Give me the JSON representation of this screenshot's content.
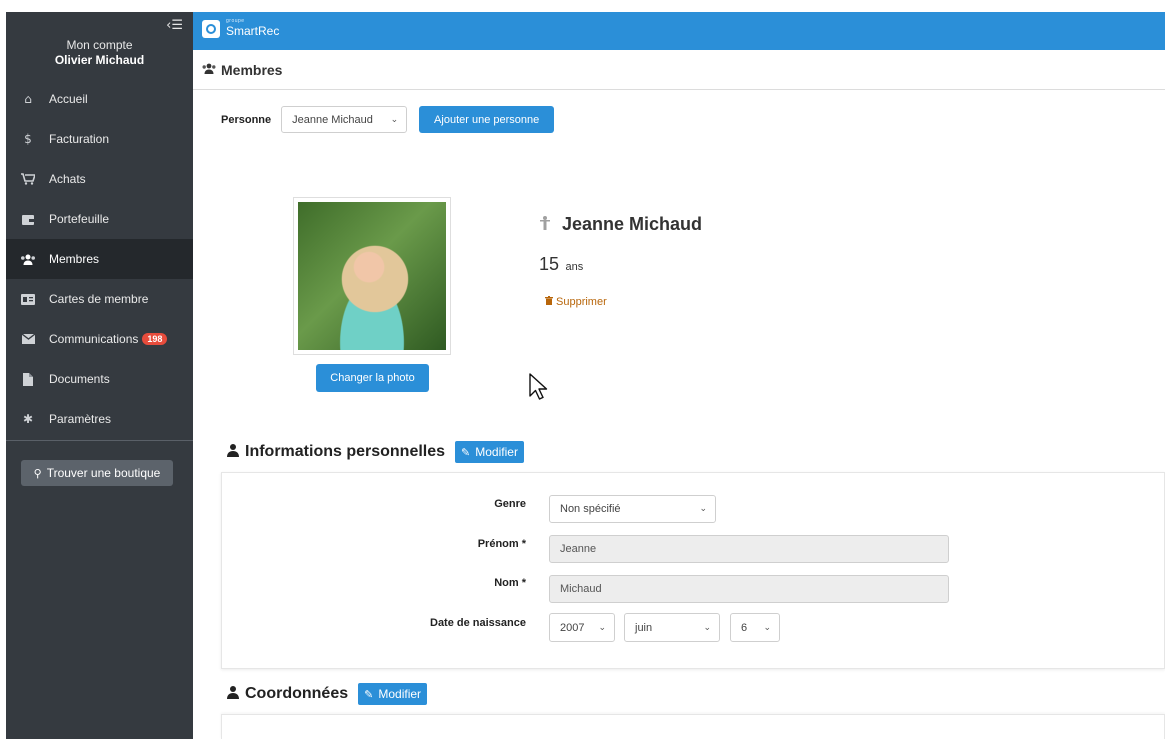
{
  "sidebar": {
    "collapse_icon": "collapse-menu-icon",
    "account_label": "Mon compte",
    "account_name": "Olivier Michaud",
    "items": [
      {
        "label": "Accueil",
        "icon": "home-icon"
      },
      {
        "label": "Facturation",
        "icon": "dollar-icon"
      },
      {
        "label": "Achats",
        "icon": "cart-icon"
      },
      {
        "label": "Portefeuille",
        "icon": "wallet-icon"
      },
      {
        "label": "Membres",
        "icon": "users-icon",
        "active": true
      },
      {
        "label": "Cartes de membre",
        "icon": "id-card-icon"
      },
      {
        "label": "Communications",
        "icon": "envelope-icon",
        "badge": "198"
      },
      {
        "label": "Documents",
        "icon": "file-icon"
      },
      {
        "label": "Paramètres",
        "icon": "gear-icon"
      }
    ],
    "find_shop_label": "Trouver une boutique"
  },
  "topbar": {
    "logo_sup": "groupe",
    "logo_text": "SmartRec"
  },
  "header": {
    "title": "Membres"
  },
  "person": {
    "label": "Personne",
    "selected": "Jeanne Michaud",
    "add_button": "Ajouter une personne"
  },
  "profile": {
    "change_photo": "Changer la photo",
    "name": "Jeanne Michaud",
    "age_value": "15",
    "age_unit": "ans",
    "delete_label": "Supprimer"
  },
  "personal_info": {
    "title": "Informations personnelles",
    "edit_label": "Modifier",
    "fields": {
      "gender_label": "Genre",
      "gender_value": "Non spécifié",
      "firstname_label": "Prénom *",
      "firstname_value": "Jeanne",
      "lastname_label": "Nom *",
      "lastname_value": "Michaud",
      "birthdate_label": "Date de naissance",
      "birth_year": "2007",
      "birth_month": "juin",
      "birth_day": "6"
    }
  },
  "contact": {
    "title": "Coordonnées",
    "edit_label": "Modifier"
  },
  "colors": {
    "sidebar_bg": "#353a40",
    "primary": "#2b8fd8",
    "badge": "#e74c3c",
    "delete": "#b8660b"
  }
}
